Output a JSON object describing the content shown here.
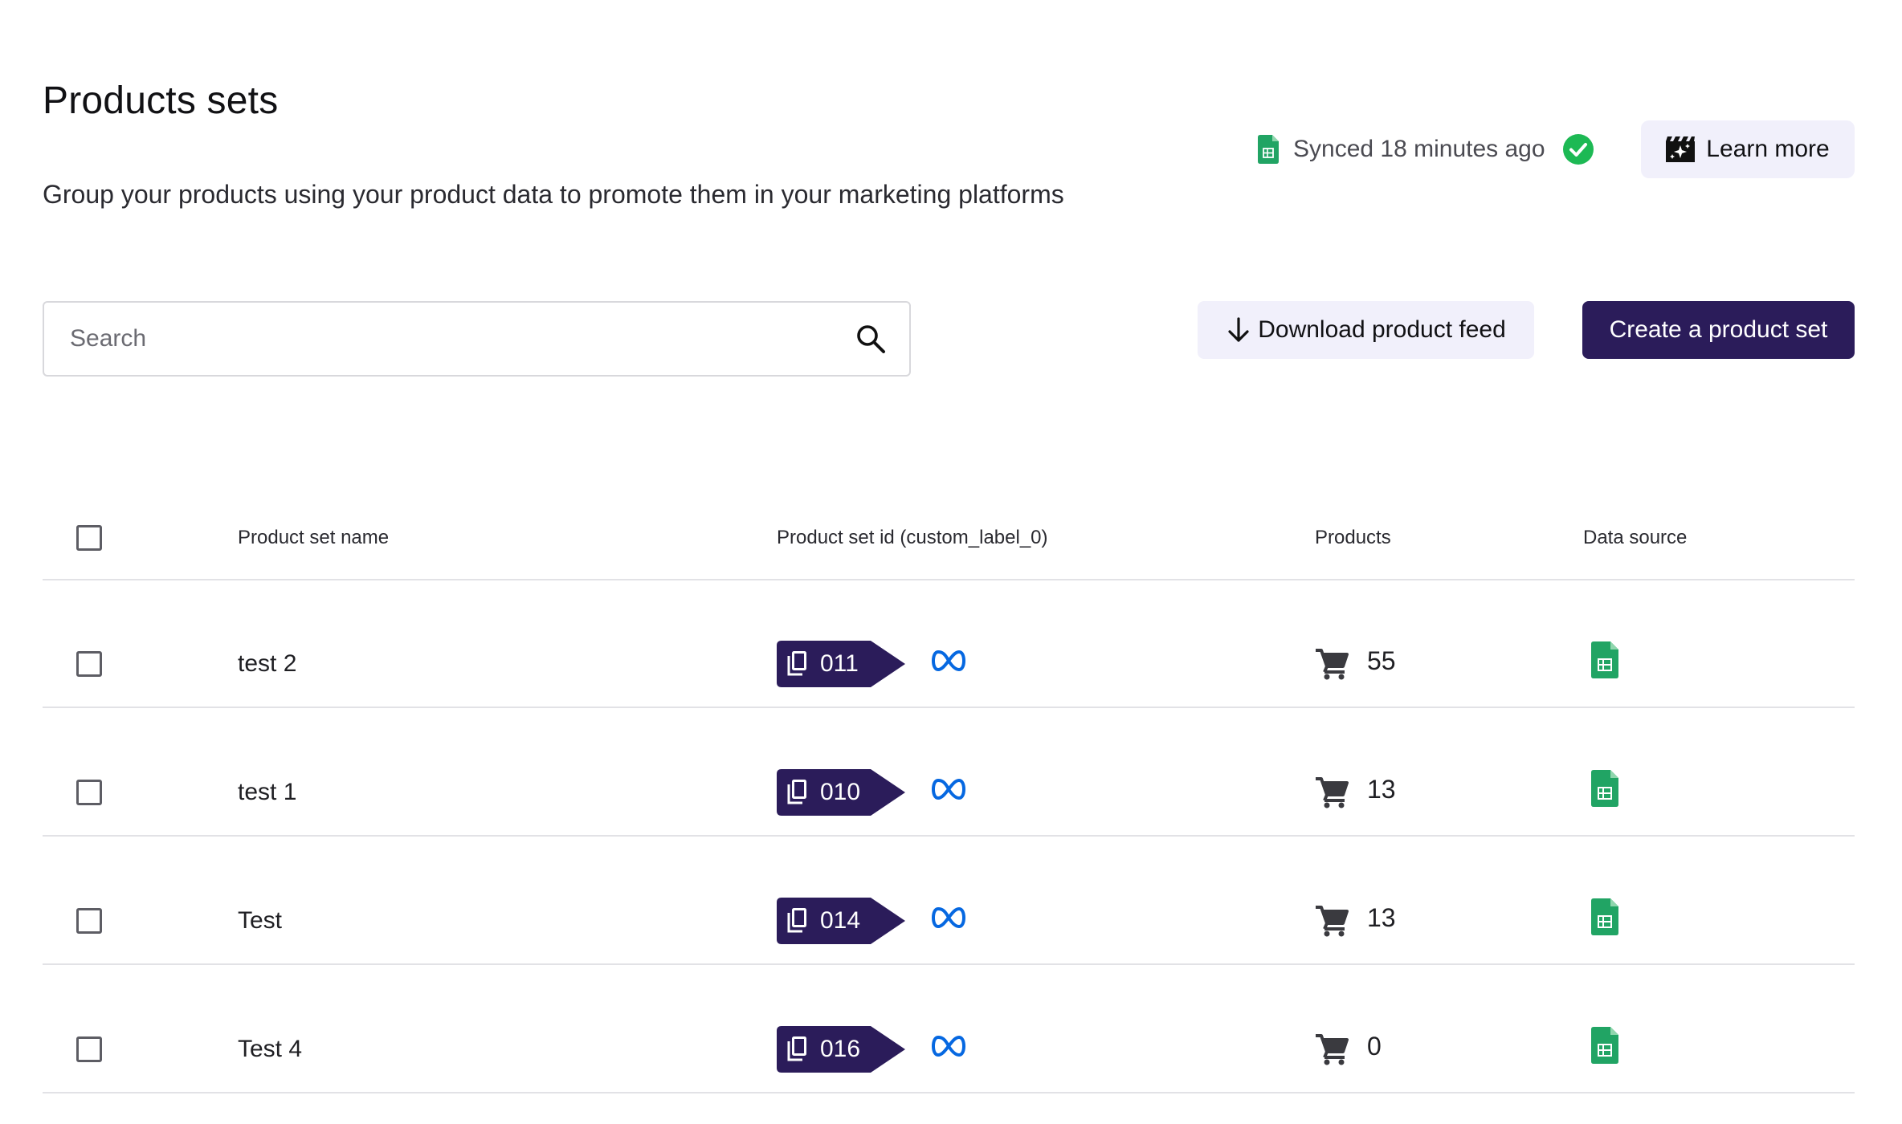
{
  "header": {
    "title": "Products sets",
    "subtitle": "Group your products using your product data to promote them in your marketing platforms",
    "sync_status": "Synced 18 minutes ago",
    "learn_more_label": "Learn more"
  },
  "toolbar": {
    "search_placeholder": "Search",
    "download_label": "Download product feed",
    "create_label": "Create a product set"
  },
  "table": {
    "columns": [
      "Product set name",
      "Product set id (custom_label_0)",
      "Products",
      "Data source"
    ],
    "rows": [
      {
        "name": "test 2",
        "id": "011",
        "products": "55"
      },
      {
        "name": "test 1",
        "id": "010",
        "products": "13"
      },
      {
        "name": "Test",
        "id": "014",
        "products": "13"
      },
      {
        "name": "Test 4",
        "id": "016",
        "products": "0"
      }
    ]
  },
  "colors": {
    "primary": "#2b1c5a",
    "secondary_bg": "#f1f0fb",
    "success": "#1db954",
    "sheets_green": "#21a464",
    "meta_blue": "#0668e1"
  },
  "icons": {
    "sheets": "google-sheets-icon",
    "check": "check-circle-icon",
    "video": "video-sparkle-icon",
    "search": "search-icon",
    "download": "arrow-down-icon",
    "copy": "copy-icon",
    "meta": "meta-logo-icon",
    "cart": "cart-icon"
  }
}
